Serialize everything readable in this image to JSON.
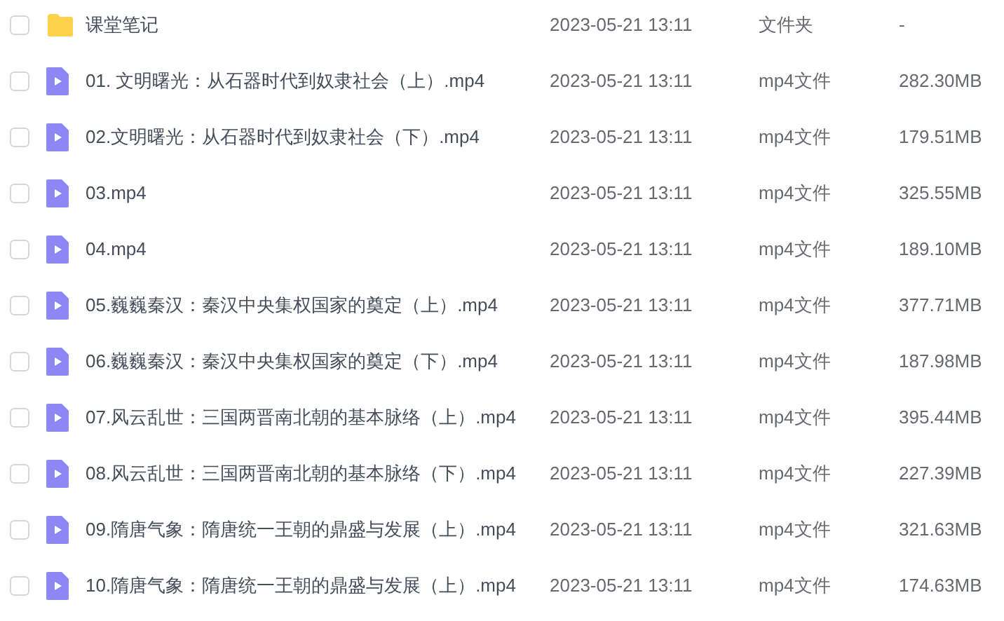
{
  "files": [
    {
      "kind": "folder",
      "checked": false,
      "name": "课堂笔记",
      "modified": "2023-05-21 13:11",
      "type": "文件夹",
      "size": "-"
    },
    {
      "kind": "video",
      "checked": false,
      "name": "01. 文明曙光：从石器时代到奴隶社会（上）.mp4",
      "modified": "2023-05-21 13:11",
      "type": "mp4文件",
      "size": "282.30MB"
    },
    {
      "kind": "video",
      "checked": false,
      "name": "02.文明曙光：从石器时代到奴隶社会（下）.mp4",
      "modified": "2023-05-21 13:11",
      "type": "mp4文件",
      "size": "179.51MB"
    },
    {
      "kind": "video",
      "checked": false,
      "name": "03.mp4",
      "modified": "2023-05-21 13:11",
      "type": "mp4文件",
      "size": "325.55MB"
    },
    {
      "kind": "video",
      "checked": false,
      "name": "04.mp4",
      "modified": "2023-05-21 13:11",
      "type": "mp4文件",
      "size": "189.10MB"
    },
    {
      "kind": "video",
      "checked": false,
      "name": "05.巍巍秦汉：秦汉中央集权国家的奠定（上）.mp4",
      "modified": "2023-05-21 13:11",
      "type": "mp4文件",
      "size": "377.71MB"
    },
    {
      "kind": "video",
      "checked": false,
      "name": "06.巍巍秦汉：秦汉中央集权国家的奠定（下）.mp4",
      "modified": "2023-05-21 13:11",
      "type": "mp4文件",
      "size": "187.98MB"
    },
    {
      "kind": "video",
      "checked": false,
      "name": "07.风云乱世：三国两晋南北朝的基本脉络（上）.mp4",
      "modified": "2023-05-21 13:11",
      "type": "mp4文件",
      "size": "395.44MB"
    },
    {
      "kind": "video",
      "checked": false,
      "name": "08.风云乱世：三国两晋南北朝的基本脉络（下）.mp4",
      "modified": "2023-05-21 13:11",
      "type": "mp4文件",
      "size": "227.39MB"
    },
    {
      "kind": "video",
      "checked": false,
      "name": "09.隋唐气象：隋唐统一王朝的鼎盛与发展（上）.mp4",
      "modified": "2023-05-21 13:11",
      "type": "mp4文件",
      "size": "321.63MB"
    },
    {
      "kind": "video",
      "checked": false,
      "name": "10.隋唐气象：隋唐统一王朝的鼎盛与发展（上）.mp4",
      "modified": "2023-05-21 13:11",
      "type": "mp4文件",
      "size": "174.63MB"
    }
  ]
}
